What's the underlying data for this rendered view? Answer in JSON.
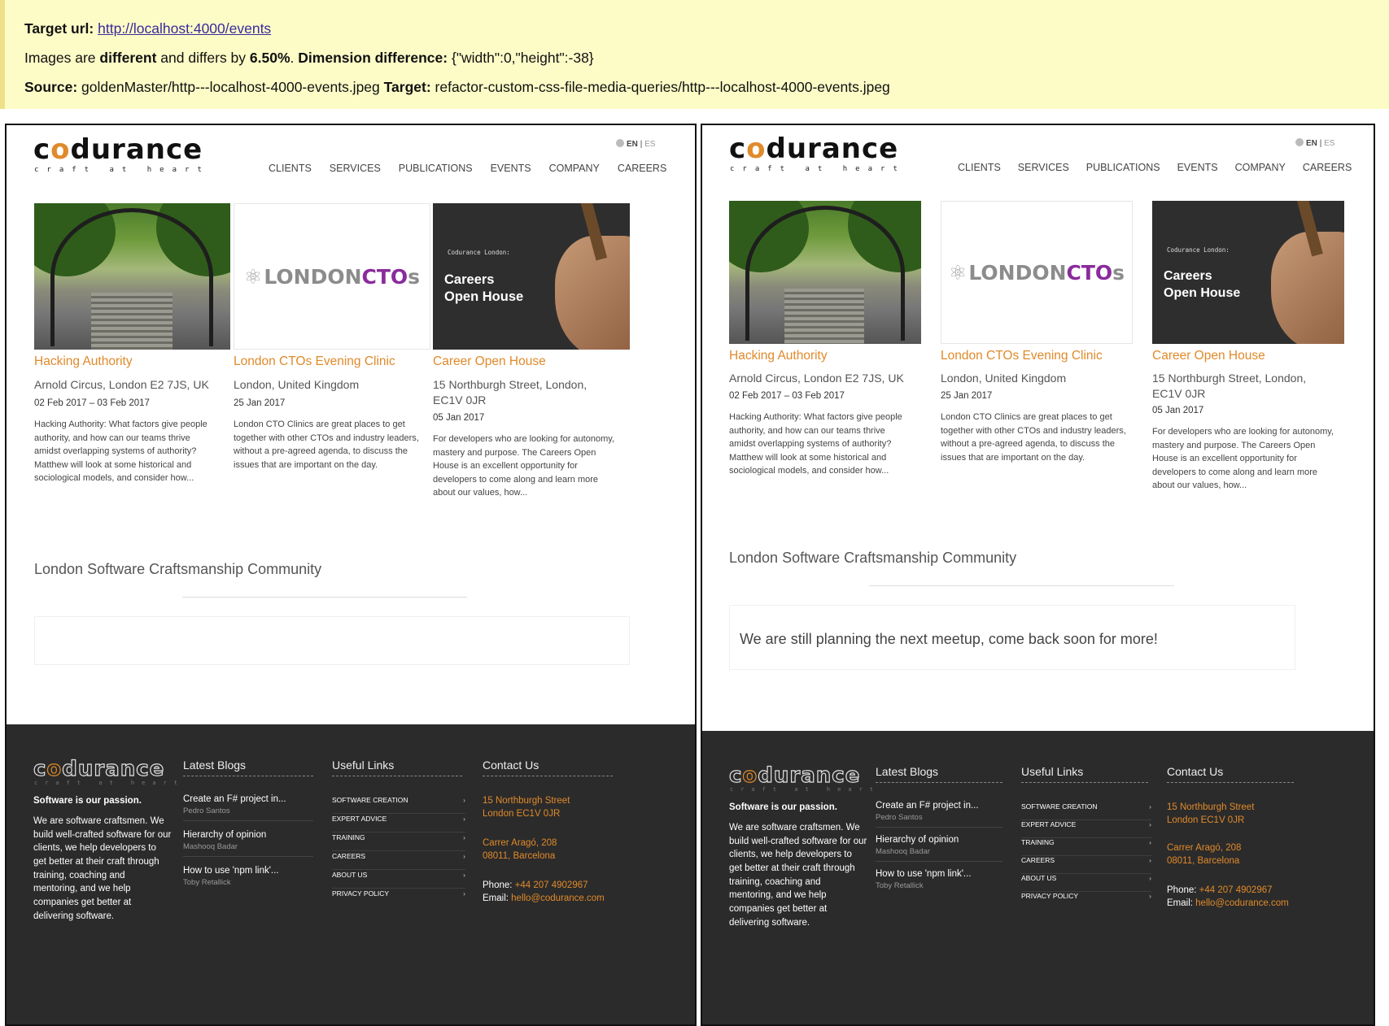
{
  "report": {
    "target_label": "Target url:",
    "target_url": "http://localhost:4000/events",
    "line2_prefix": "Images are",
    "line2_diff": "different",
    "line2_mid": "and differs by",
    "line2_percent": "6.50%",
    "line2_dot": ".",
    "dim_label": "Dimension difference:",
    "dim_value": "{\"width\":0,\"height\":-38}",
    "source_label": "Source:",
    "source_value": "goldenMaster/http---localhost-4000-events.jpeg",
    "target2_label": "Target:",
    "target2_value": "refactor-custom-css-file-media-queries/http---localhost-4000-events.jpeg"
  },
  "site": {
    "logo_pre": "c",
    "logo_o": "o",
    "logo_post": "durance",
    "tagline": "craft at heart",
    "lang_en": "EN",
    "lang_sep": "|",
    "lang_es": "ES",
    "nav": [
      "CLIENTS",
      "SERVICES",
      "PUBLICATIONS",
      "EVENTS",
      "COMPANY",
      "CAREERS"
    ],
    "cto_logo_pre": "LONDON",
    "cto_logo_hl": "CTO",
    "cto_logo_post": "s",
    "careers_small": "Codurance London:",
    "careers_big_1": "Careers",
    "careers_big_2": "Open House",
    "events": [
      {
        "title": "Hacking Authority",
        "location": "Arnold Circus, London E2 7JS, UK",
        "date": "02 Feb 2017 – 03 Feb 2017",
        "desc": "Hacking Authority: What factors give people authority, and how can our teams thrive amidst overlapping systems of authority? Matthew will look at some historical and sociological models, and consider how..."
      },
      {
        "title": "London CTOs Evening Clinic",
        "location": "London, United Kingdom",
        "date": "25 Jan 2017",
        "desc": "London CTO Clinics are great places to get together with other CTOs and industry leaders, without a pre-agreed agenda, to discuss the issues that are important on the day."
      },
      {
        "title": "Career Open House",
        "location": "15 Northburgh Street, London, EC1V 0JR",
        "date": "05 Jan 2017",
        "desc": "For developers who are looking for autonomy, mastery and purpose. The Careers Open House is an excellent opportunity for developers to come along and learn more about our values, how..."
      }
    ],
    "community_title": "London Software Craftsmanship Community",
    "meetup_message": "We are still planning the next meetup, come back soon for more!",
    "footer": {
      "passion": "Software is our passion.",
      "about": "We are software craftsmen. We build well-crafted software for our clients, we help developers to get better at their craft through training, coaching and mentoring, and we help companies get better at delivering software.",
      "blogs_heading": "Latest Blogs",
      "blogs": [
        {
          "title": "Create an F# project in...",
          "author": "Pedro Santos"
        },
        {
          "title": "Hierarchy of opinion",
          "author": "Mashooq Badar"
        },
        {
          "title": "How to use 'npm link'...",
          "author": "Toby Retallick"
        }
      ],
      "links_heading": "Useful Links",
      "links": [
        "SOFTWARE CREATION",
        "EXPERT ADVICE",
        "TRAINING",
        "CAREERS",
        "ABOUT US",
        "PRIVACY POLICY"
      ],
      "chevron": "›",
      "contact_heading": "Contact Us",
      "addr1_line1": "15 Northburgh Street",
      "addr1_line2": "London EC1V 0JR",
      "addr2_line1": "Carrer Aragó, 208",
      "addr2_line2": "08011, Barcelona",
      "phone_label": "Phone:",
      "phone": "+44 207 4902967",
      "email_label": "Email:",
      "email": "hello@codurance.com"
    }
  },
  "colors": {
    "accent": "#e08a2b",
    "report_bg": "#fdfcc7",
    "footer_bg": "#2b2b2b",
    "cto_highlight": "#8a2b9c"
  }
}
